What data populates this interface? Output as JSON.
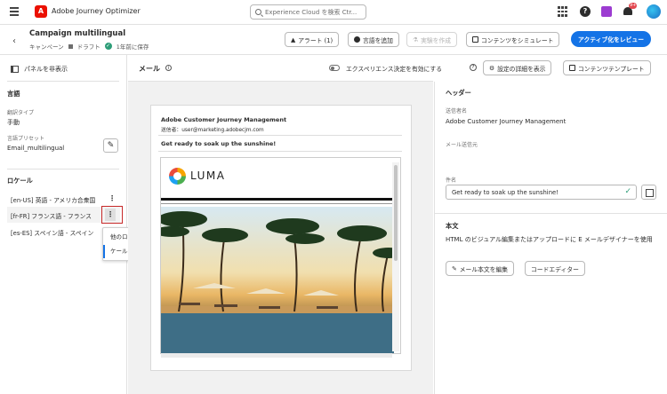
{
  "topbar": {
    "app_name": "Adobe Journey Optimizer",
    "logo_letter": "A",
    "search_placeholder": "Experience Cloud を検索 Ctr...",
    "notification_count": "9+",
    "icons": [
      "menu-icon",
      "apps-grid-icon",
      "help-icon",
      "chat-icon",
      "bell-icon",
      "avatar"
    ]
  },
  "header": {
    "back_glyph": "‹",
    "title": "Campaign multilingual",
    "meta_type": "キャンペーン",
    "meta_status": "ドラフト",
    "meta_saved": "1年前に保存",
    "buttons": {
      "alerts": "アラート (1)",
      "add_language": "言語を追加",
      "create_experiment": "実験を作成",
      "simulate": "コンテンツをシミュレート",
      "review_activate": "アクティブ化をレビュー"
    }
  },
  "left_panel": {
    "hide_panel": "パネルを非表示",
    "language_section": "言語",
    "translation_type_label": "翻訳タイプ",
    "translation_type_value": "手動",
    "language_preset_label": "言語プリセット",
    "language_preset_value": "Email_multilingual",
    "locale_section": "ロケール",
    "locales": [
      "[en-US] 英語 - アメリカ合衆国",
      "[fr-FR] フランス語 - フランス",
      "[es-ES] スペイン語 - スペイン"
    ],
    "context_menu": {
      "copy": "他のロケールにコピー",
      "disable": "ケールを無効にする"
    }
  },
  "middle": {
    "title": "メール",
    "experience_toggle_label": "エクスペリエンス決定を有効にする",
    "settings_button": "設定の詳細を表示",
    "template_button": "コンテンツテンプレート",
    "email": {
      "from_name": "Adobe Customer Journey Management",
      "sender": "送信者：user@marketing.adobecjm.com",
      "subject": "Get ready to soak up the sunshine!",
      "brand": "LUMA"
    }
  },
  "right_panel": {
    "header_section": "ヘッダー",
    "sender_name_label": "送信者名",
    "sender_name_value": "Adobe Customer Journey Management",
    "sender_email_label": "メール送信元",
    "subject_label": "件名",
    "subject_value": "Get ready to soak up the sunshine!",
    "body_section": "本文",
    "body_description": "HTML のビジュアル編集またはアップロードに E メールデザイナーを使用",
    "edit_body_button": "メール本文を編集",
    "code_editor_button": "コードエディター"
  },
  "colors": {
    "primary": "#1473e6",
    "adobe_red": "#eb1000",
    "highlight_border": "#c62828",
    "success": "#2d9d78"
  }
}
